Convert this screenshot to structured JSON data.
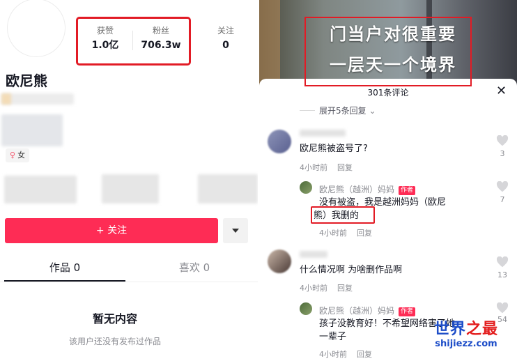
{
  "profile": {
    "username": "欧尼熊",
    "stats": [
      {
        "label": "获赞",
        "value": "1.0亿"
      },
      {
        "label": "粉丝",
        "value": "706.3w"
      },
      {
        "label": "关注",
        "value": "0"
      }
    ],
    "gender_label": "女",
    "follow_label": "+ 关注",
    "tabs": [
      {
        "label": "作品 0",
        "active": true
      },
      {
        "label": "喜欢 0",
        "active": false
      }
    ],
    "empty_title": "暂无内容",
    "empty_subtitle": "该用户还没有发布过作品"
  },
  "video": {
    "overlay_lines": [
      "门当户对很重要",
      "一层天一个境界"
    ]
  },
  "comments_panel": {
    "title": "301条评论",
    "expand_replies": "展开5条回复",
    "comments": [
      {
        "user": "",
        "text": "欧尼熊被盗号了?",
        "time": "4小时前",
        "reply": "回复",
        "likes": "3"
      },
      {
        "user": "欧尼熊（越洲）妈妈",
        "tag": "作者",
        "text_line1": "没有被盗，我是越洲妈妈（欧尼",
        "text_line2": "熊）我删的",
        "time": "4小时前",
        "reply": "回复",
        "likes": "7"
      },
      {
        "user": "",
        "text": "什么情况啊 为啥删作品啊",
        "time": "4小时前",
        "reply": "回复",
        "likes": "13"
      },
      {
        "user": "欧尼熊（越洲）妈妈",
        "tag": "作者",
        "text_line1": "孩子没教育好！不希望网络害了她",
        "text_line2": "一辈子",
        "time": "4小时前",
        "reply": "回复",
        "likes": "54"
      }
    ]
  },
  "watermark": {
    "cn_main": "世界",
    "cn_accent": "之最",
    "url": "shijiezz.com"
  },
  "colors": {
    "accent": "#fe2c55",
    "highlight_box": "#e21b25",
    "watermark_blue": "#1d4dc8"
  }
}
